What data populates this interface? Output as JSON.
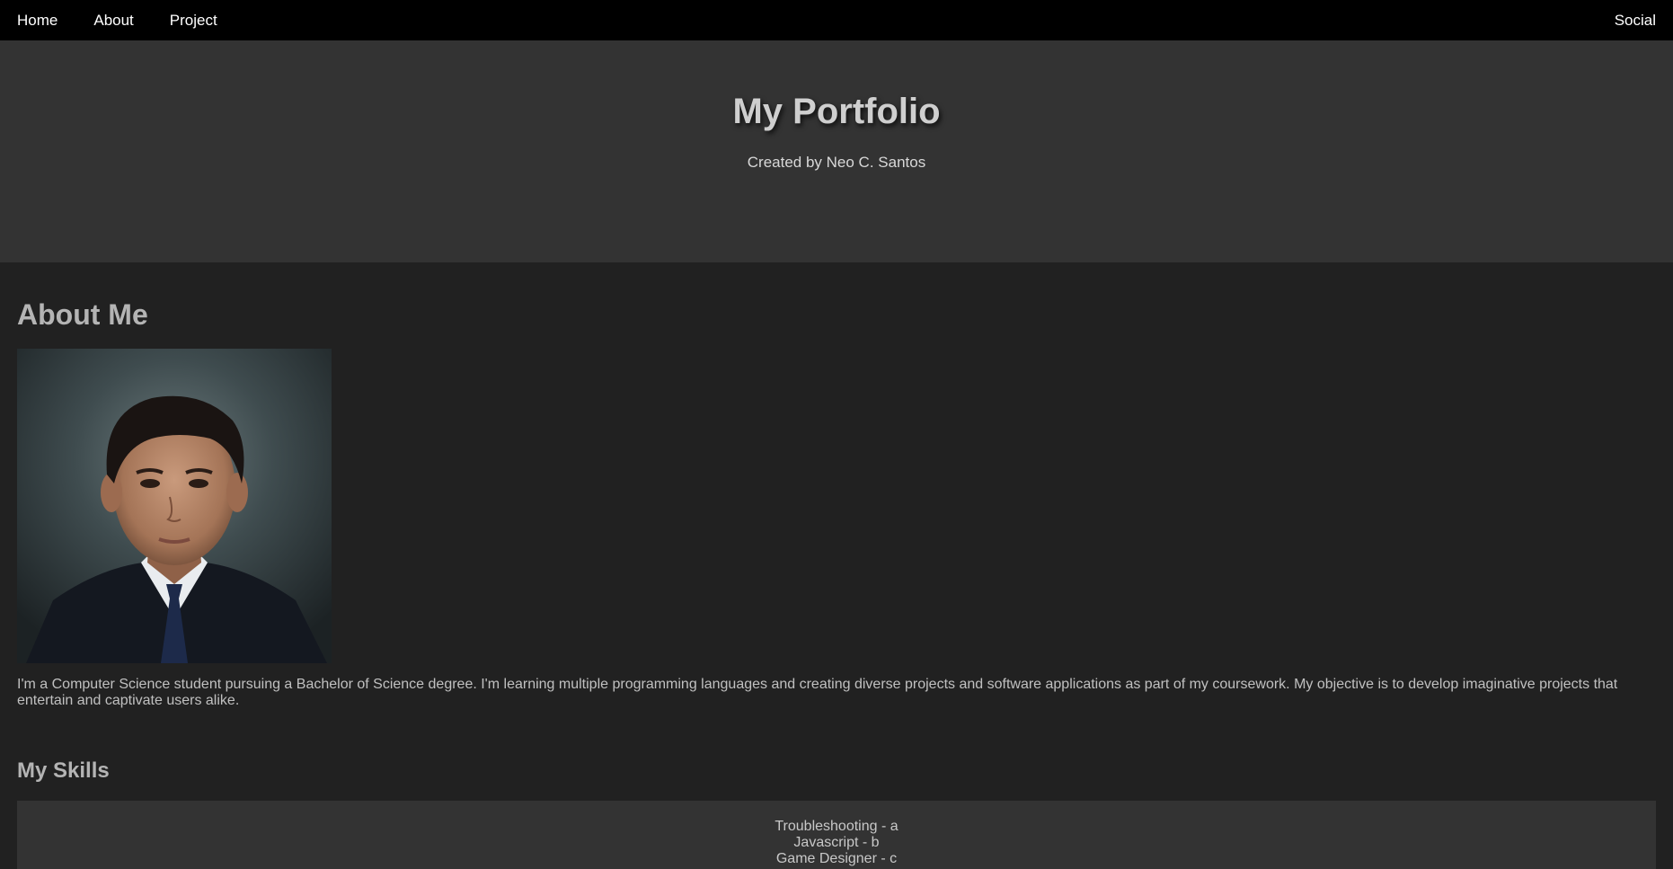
{
  "nav": {
    "home_label": "Home",
    "about_label": "About",
    "project_label": "Project",
    "social_label": "Social"
  },
  "hero": {
    "title": "My Portfolio",
    "subtitle": "Created by Neo C. Santos"
  },
  "about": {
    "title": "About Me",
    "description": "I'm a Computer Science student pursuing a Bachelor of Science degree. I'm learning multiple programming languages and creating diverse projects and software applications as part of my coursework. My objective is to develop imaginative projects that entertain and captivate users alike."
  },
  "skills": {
    "title": "My Skills",
    "items": [
      "Troubleshooting - a",
      "Javascript - b",
      "Game Designer - c"
    ]
  },
  "colors": {
    "nav_bg": "#000000",
    "hero_bg": "#333333",
    "page_bg": "#212121",
    "heading": "#b4b4b4"
  }
}
